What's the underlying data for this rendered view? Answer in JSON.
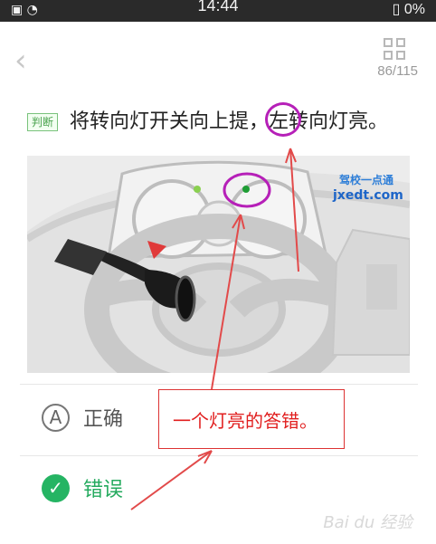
{
  "status": {
    "left_icons": "▣ ◔",
    "time": "14:44",
    "battery": "0%"
  },
  "header": {
    "back_icon": "‹",
    "progress": "86/115"
  },
  "question": {
    "tag": "判断",
    "text": "将转向灯开关向上提，左转向灯亮。"
  },
  "image": {
    "brand_line_1": "驾校一点通",
    "brand_line_2": "jxedt.com"
  },
  "options": [
    {
      "letter": "A",
      "label": "正确"
    },
    {
      "letter": "✓",
      "label": "错误"
    }
  ],
  "annotation": {
    "text": "一个灯亮的答错。"
  },
  "watermark": {
    "text": "Bai du 经验"
  },
  "colors": {
    "accent_green": "#25b463",
    "annotation_red": "#e11e1e",
    "highlight_purple": "#b620b8"
  }
}
